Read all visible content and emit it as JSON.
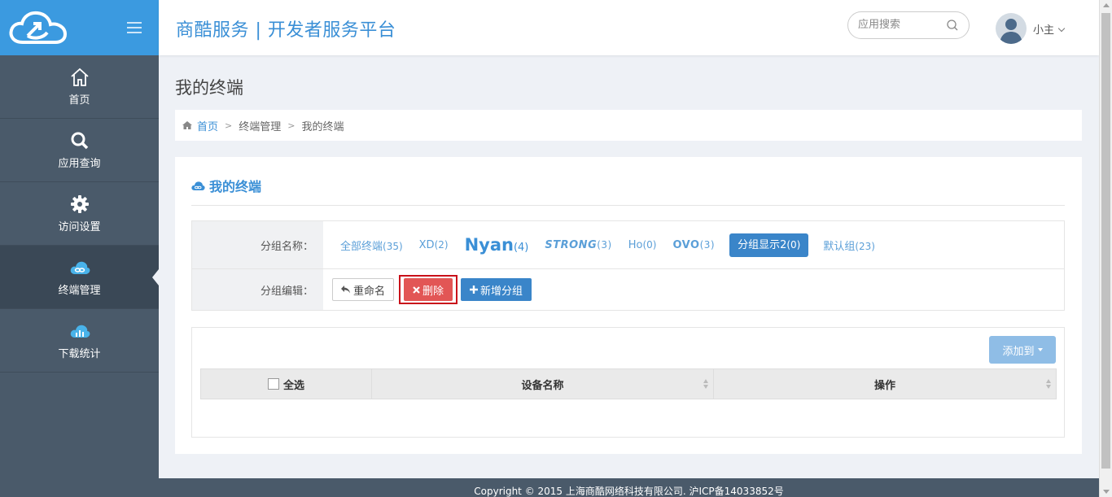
{
  "sidebar": {
    "items": [
      {
        "label": "首页",
        "icon": "home-icon"
      },
      {
        "label": "应用查询",
        "icon": "search-icon"
      },
      {
        "label": "访问设置",
        "icon": "gear-icon"
      },
      {
        "label": "终端管理",
        "icon": "cloud-link-icon",
        "active": true
      },
      {
        "label": "下载统计",
        "icon": "cloud-chart-icon"
      }
    ]
  },
  "header": {
    "title": "商酷服务 | 开发者服务平台",
    "search_placeholder": "应用搜索",
    "username": "小主"
  },
  "page": {
    "title": "我的终端",
    "breadcrumb": [
      "首页",
      "终端管理",
      "我的终端"
    ]
  },
  "panel": {
    "title": "我的终端",
    "group_label": "分组名称：",
    "edit_label": "分组编辑：",
    "groups": [
      {
        "name": "全部终端",
        "count": "(35)"
      },
      {
        "name": "XD",
        "count": "(2)"
      },
      {
        "name": "Nyan",
        "count": "(4)"
      },
      {
        "name": "STRONG",
        "count": "(3)"
      },
      {
        "name": "Ho",
        "count": "(0)"
      },
      {
        "name": "OVO",
        "count": "(3)"
      },
      {
        "name": "分组显示2",
        "count": "(0)",
        "selected": true
      },
      {
        "name": "默认组",
        "count": "(23)"
      }
    ],
    "buttons": {
      "rename": "重命名",
      "delete": "删除",
      "add_group": "新增分组"
    },
    "add_to": "添加到",
    "table": {
      "select_all": "全选",
      "columns": [
        "设备名称",
        "操作"
      ]
    }
  },
  "footer": {
    "copyright": "Copyright © 2015 上海商酷网络科技有限公司. 沪ICP备14033852号"
  },
  "colors": {
    "sidebar": "#4a5a6a",
    "brand": "#3b9ae0",
    "danger": "#e25655",
    "primary": "#3a85c9",
    "highlight": "#c9101a"
  }
}
